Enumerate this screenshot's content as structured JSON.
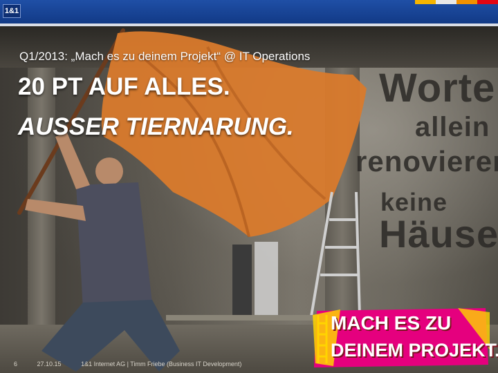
{
  "header": {
    "logo_text": "1&1",
    "stripe_colors": [
      "#f7b500",
      "#e8e8e8",
      "#f29100",
      "#e30613",
      "#f7b500"
    ]
  },
  "slide": {
    "subtitle": "Q1/2013: „Mach es zu deinem Projekt“ @ IT Operations",
    "headline_1": "20 PT AUF ALLES.",
    "headline_2": "AUSSER TIERNARUNG."
  },
  "wall": {
    "line_1": "Worte",
    "line_2": "allein",
    "line_3": "renovieren",
    "line_4": "keine",
    "line_5": "Häuser."
  },
  "badge": {
    "line_1": "MACH ES ZU",
    "line_2": "DEINEM PROJEKT.",
    "colors": {
      "pink": "#e5007e",
      "yellow": "#ffd400",
      "red": "#c8102e"
    }
  },
  "footer": {
    "page_number": "6",
    "date": "27.10.15",
    "company": "1&1 Internet AG | Timm Friebe (Business IT Development)"
  }
}
